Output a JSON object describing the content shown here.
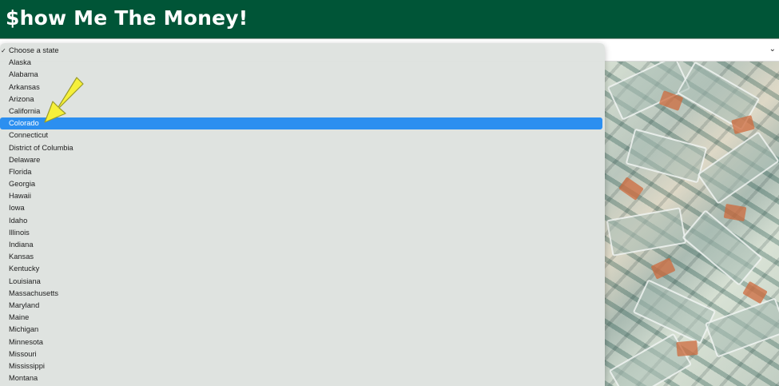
{
  "header": {
    "title": "$how Me The Money!"
  },
  "state_select": {
    "selected_label": "Choose a state",
    "highlighted": "Colorado",
    "options": [
      "Choose a state",
      "Alaska",
      "Alabama",
      "Arkansas",
      "Arizona",
      "California",
      "Colorado",
      "Connecticut",
      "District of Columbia",
      "Delaware",
      "Florida",
      "Georgia",
      "Hawaii",
      "Iowa",
      "Idaho",
      "Illinois",
      "Indiana",
      "Kansas",
      "Kentucky",
      "Louisiana",
      "Massachusetts",
      "Maryland",
      "Maine",
      "Michigan",
      "Minnesota",
      "Missouri",
      "Mississippi",
      "Montana"
    ]
  },
  "icons": {
    "checkmark": "checkmark-icon",
    "chevron": "chevron-down-icon",
    "pointer": "yellow-arrow-annotation"
  },
  "colors": {
    "header_bg": "#005537",
    "highlight": "#2c8ff0",
    "arrow": "#f6f03a"
  }
}
